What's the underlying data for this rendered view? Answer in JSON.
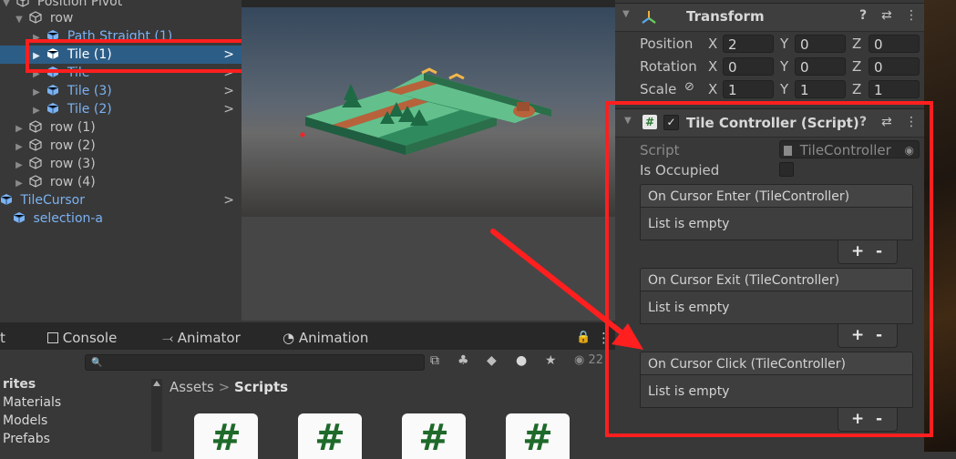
{
  "hierarchy": {
    "items": [
      {
        "label": "Position Pivot",
        "arrow": "▼",
        "color": "gray"
      },
      {
        "label": "row",
        "arrow": "▼",
        "color": "gray"
      },
      {
        "label": "Path Straight (1)",
        "arrow": "▶",
        "color": "blue"
      },
      {
        "label": "Tile (1)",
        "arrow": "▶",
        "color": "white"
      },
      {
        "label": "Tile",
        "arrow": "▶",
        "color": "blue"
      },
      {
        "label": "Tile (3)",
        "arrow": "▶",
        "color": "blue"
      },
      {
        "label": "Tile (2)",
        "arrow": "▶",
        "color": "blue"
      },
      {
        "label": "row (1)",
        "arrow": "▶",
        "color": "gray"
      },
      {
        "label": "row (2)",
        "arrow": "▶",
        "color": "gray"
      },
      {
        "label": "row (3)",
        "arrow": "▶",
        "color": "gray"
      },
      {
        "label": "row (4)",
        "arrow": "▶",
        "color": "gray"
      },
      {
        "label": "TileCursor",
        "arrow": "",
        "color": "blue"
      },
      {
        "label": "selection-a",
        "arrow": "",
        "color": "blue"
      }
    ],
    "chevron": ">"
  },
  "bottom_tabs": {
    "console": "Console",
    "animator": "Animator",
    "animation": "Animation",
    "lock": "🔒",
    "more": "⋮",
    "left_fragment": "t"
  },
  "project": {
    "search_icon": "🔍",
    "hidden_count": "22",
    "left_items": [
      "rites",
      "Materials",
      "Models",
      "Prefabs"
    ],
    "breadcrumb_root": "Assets",
    "breadcrumb_sep": ">",
    "breadcrumb_current": "Scripts",
    "script_glyph": "#"
  },
  "inspector": {
    "transform_title": "Transform",
    "position_label": "Position",
    "rotation_label": "Rotation",
    "scale_label": "Scale",
    "axis_x": "X",
    "axis_y": "Y",
    "axis_z": "Z",
    "position": {
      "x": "2",
      "y": "0",
      "z": "0"
    },
    "rotation": {
      "x": "0",
      "y": "0",
      "z": "0"
    },
    "scale": {
      "x": "1",
      "y": "1",
      "z": "1"
    },
    "component_title": "Tile Controller (Script)",
    "script_label": "Script",
    "script_value": "TileController",
    "is_occupied_label": "Is Occupied",
    "events": [
      {
        "title": "On Cursor Enter (TileController)",
        "body": "List is empty"
      },
      {
        "title": "On Cursor Exit (TileController)",
        "body": "List is empty"
      },
      {
        "title": "On Cursor Click (TileController)",
        "body": "List is empty"
      }
    ],
    "plus": "+",
    "minus": "-",
    "help": "?",
    "settings": "⇄",
    "more": "⋮",
    "hash": "#",
    "check": "✓"
  },
  "colors": {
    "highlight": "#ff1f1f",
    "selection": "#2c5d87",
    "prefab_blue": "#7bb2f2"
  }
}
